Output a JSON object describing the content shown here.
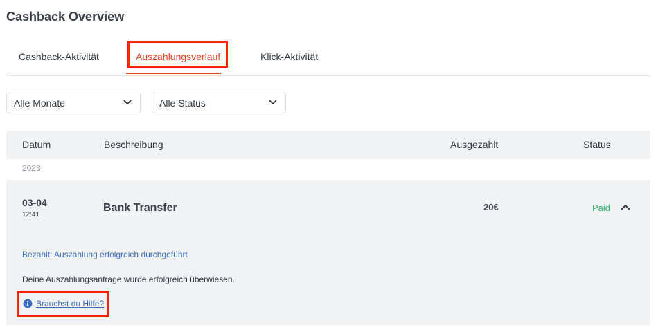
{
  "page": {
    "title": "Cashback Overview"
  },
  "tabs": [
    {
      "label": "Cashback-Aktivität",
      "active": false
    },
    {
      "label": "Auszahlungsverlauf",
      "active": true
    },
    {
      "label": "Klick-Aktivität",
      "active": false
    }
  ],
  "filters": {
    "month": {
      "selected": "Alle Monate"
    },
    "status": {
      "selected": "Alle Status"
    }
  },
  "table": {
    "columns": [
      "Datum",
      "Beschreibung",
      "Ausgezahlt",
      "Status"
    ],
    "year": "2023",
    "rows": [
      {
        "date": "03-04",
        "time": "12:41",
        "description": "Bank Transfer",
        "amount": "20€",
        "status": "Paid",
        "expanded": true,
        "detail": {
          "title": "Bezahlt: Auszahlung erfolgreich durchgeführt",
          "text": "Deine Auszahlungsanfrage wurde erfolgreich  überwiesen.",
          "help_link": "Brauchst du Hilfe?"
        }
      }
    ]
  },
  "colors": {
    "accent": "#e8452c",
    "highlight": "#ff2200",
    "paid": "#33b26e",
    "link": "#3b6fc4",
    "header_bg": "#f1f2f4"
  },
  "icons": {
    "select_chevron": "chevron-down-icon",
    "row_toggle": "chevron-up-icon",
    "help": "info-icon"
  }
}
